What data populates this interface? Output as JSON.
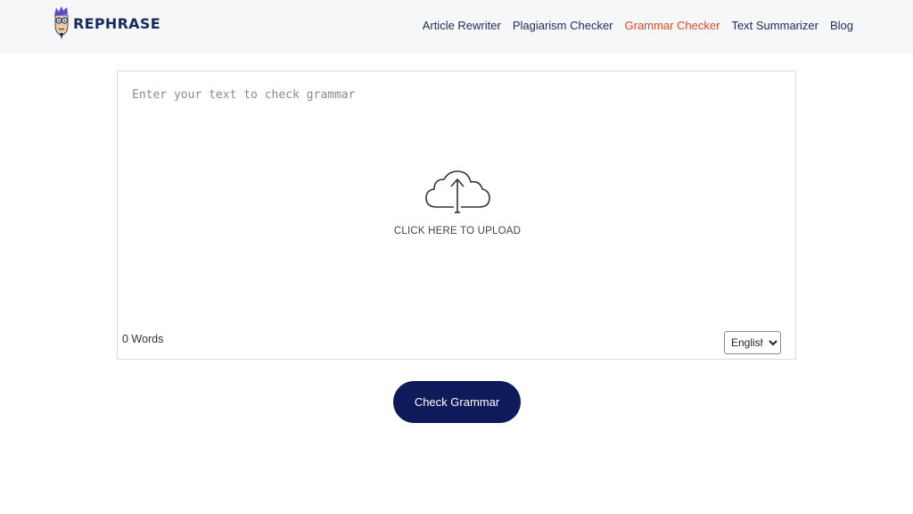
{
  "brand": {
    "name": "REPHRASE"
  },
  "nav": {
    "items": [
      {
        "label": "Article Rewriter"
      },
      {
        "label": "Plagiarism Checker"
      },
      {
        "label": "Grammar Checker",
        "active": true
      },
      {
        "label": "Text Summarizer"
      },
      {
        "label": "Blog"
      }
    ],
    "active_color": "#e0492a",
    "color": "#1e2a5a"
  },
  "editor": {
    "placeholder": "Enter your text to check grammar",
    "value": "",
    "upload_label": "CLICK HERE TO UPLOAD",
    "upload_icon": "cloud-upload-icon",
    "word_count": "0 Words",
    "language": {
      "selected": "English"
    }
  },
  "actions": {
    "check_label": "Check Grammar",
    "button_color": "#0f1a5a"
  }
}
